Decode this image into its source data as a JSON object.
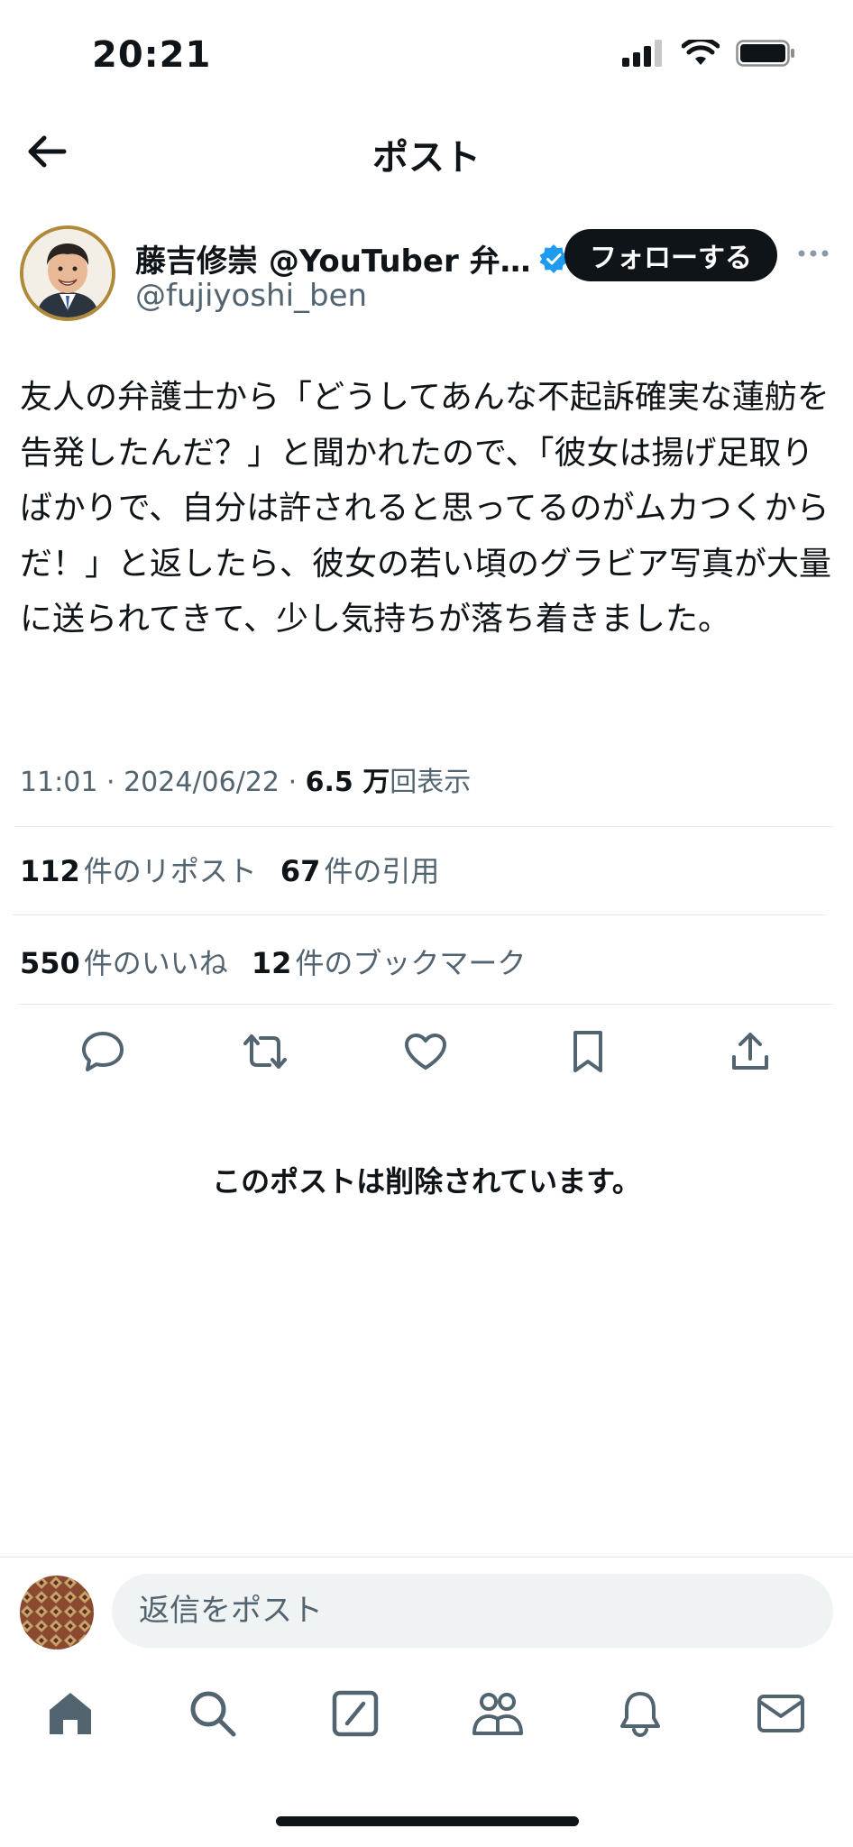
{
  "status_bar": {
    "time": "20:21"
  },
  "header": {
    "title": "ポスト"
  },
  "author": {
    "display_name": "藤吉修崇 @YouTuber 弁…",
    "handle": "@fujiyoshi_ben",
    "follow_label": "フォローする",
    "verified": true
  },
  "tweet": {
    "text": "友人の弁護士から「どうしてあんな不起訴確実な蓮舫を告発したんだ？」と聞かれたので、「彼女は揚げ足取りばかりで、自分は許されると思ってるのがムカつくからだ！」と返したら、彼女の若い頃のグラビア写真が大量に送られてきて、少し気持ちが落ち着きました。",
    "time": "11:01",
    "date": "2024/06/22",
    "views_value": "6.5 万",
    "views_label": "回表示"
  },
  "stats": {
    "reposts_value": "112",
    "reposts_label": "件のリポスト",
    "quotes_value": "67",
    "quotes_label": "件の引用",
    "likes_value": "550",
    "likes_label": "件のいいね",
    "bookmarks_value": "12",
    "bookmarks_label": "件のブックマーク"
  },
  "actions": [
    "reply-icon",
    "repost-icon",
    "like-icon",
    "bookmark-icon",
    "share-icon"
  ],
  "deleted_notice": "このポストは削除されています。",
  "reply": {
    "placeholder": "返信をポスト"
  },
  "nav": [
    "home-icon",
    "search-icon",
    "grok-icon",
    "communities-icon",
    "notifications-icon",
    "messages-icon"
  ],
  "colors": {
    "text": "#0f1419",
    "muted": "#536471",
    "verified": "#1d9bf0",
    "follow_bg": "#0f1419"
  }
}
